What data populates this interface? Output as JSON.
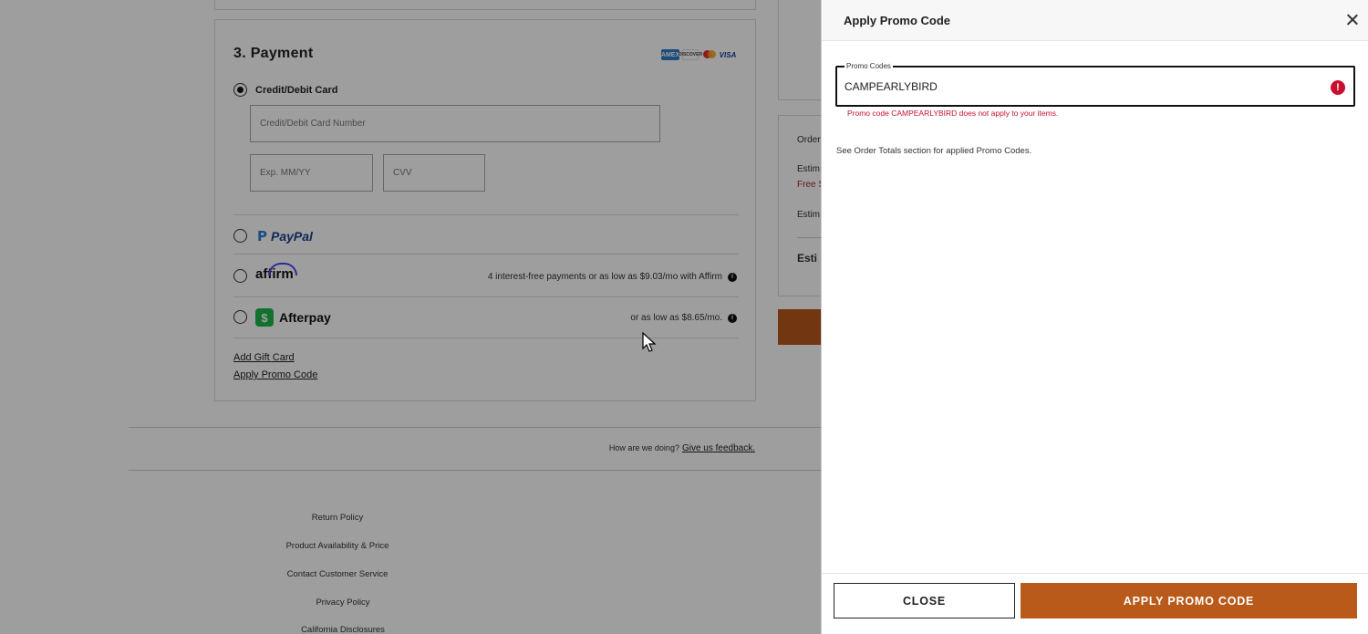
{
  "payment": {
    "title": "3. Payment",
    "card_logos": [
      "AMEX",
      "DISCOVER",
      "",
      "VISA"
    ],
    "credit": {
      "label": "Credit/Debit Card",
      "card_number_placeholder": "Credit/Debit Card Number",
      "exp_placeholder": "Exp. MM/YY",
      "cvv_placeholder": "CVV"
    },
    "paypal": {
      "label": "PayPal"
    },
    "affirm": {
      "label": "affirm",
      "note": "4 interest-free payments or as low as $9.03/mo with Affirm"
    },
    "afterpay": {
      "label": "Afterpay",
      "badge": "$",
      "note": "or as low as $8.65/mo."
    },
    "links": {
      "gift_card": "Add Gift Card",
      "promo_code": "Apply Promo Code"
    }
  },
  "order_summary": {
    "partial_labels": [
      "Order",
      "Estim",
      "Free S",
      "Estim",
      "Esti"
    ]
  },
  "feedback": {
    "prompt": "How are we doing?",
    "link": "Give us feedback."
  },
  "footer_links": [
    "Return Policy",
    "Product Availability & Price",
    "Contact Customer Service",
    "Privacy Policy",
    "California Disclosures"
  ],
  "modal": {
    "title": "Apply Promo Code",
    "field_label": "Promo Codes",
    "field_value": "CAMPEARLYBIRD",
    "error_icon": "!",
    "error_message": "Promo code CAMPEARLYBIRD does not apply to your items.",
    "hint": "See Order Totals section for applied Promo Codes.",
    "close_button": "CLOSE",
    "apply_button": "APPLY PROMO CODE"
  },
  "colors": {
    "accent": "#b95a1b",
    "error": "#c8102e",
    "afterpay": "#1eb648"
  }
}
